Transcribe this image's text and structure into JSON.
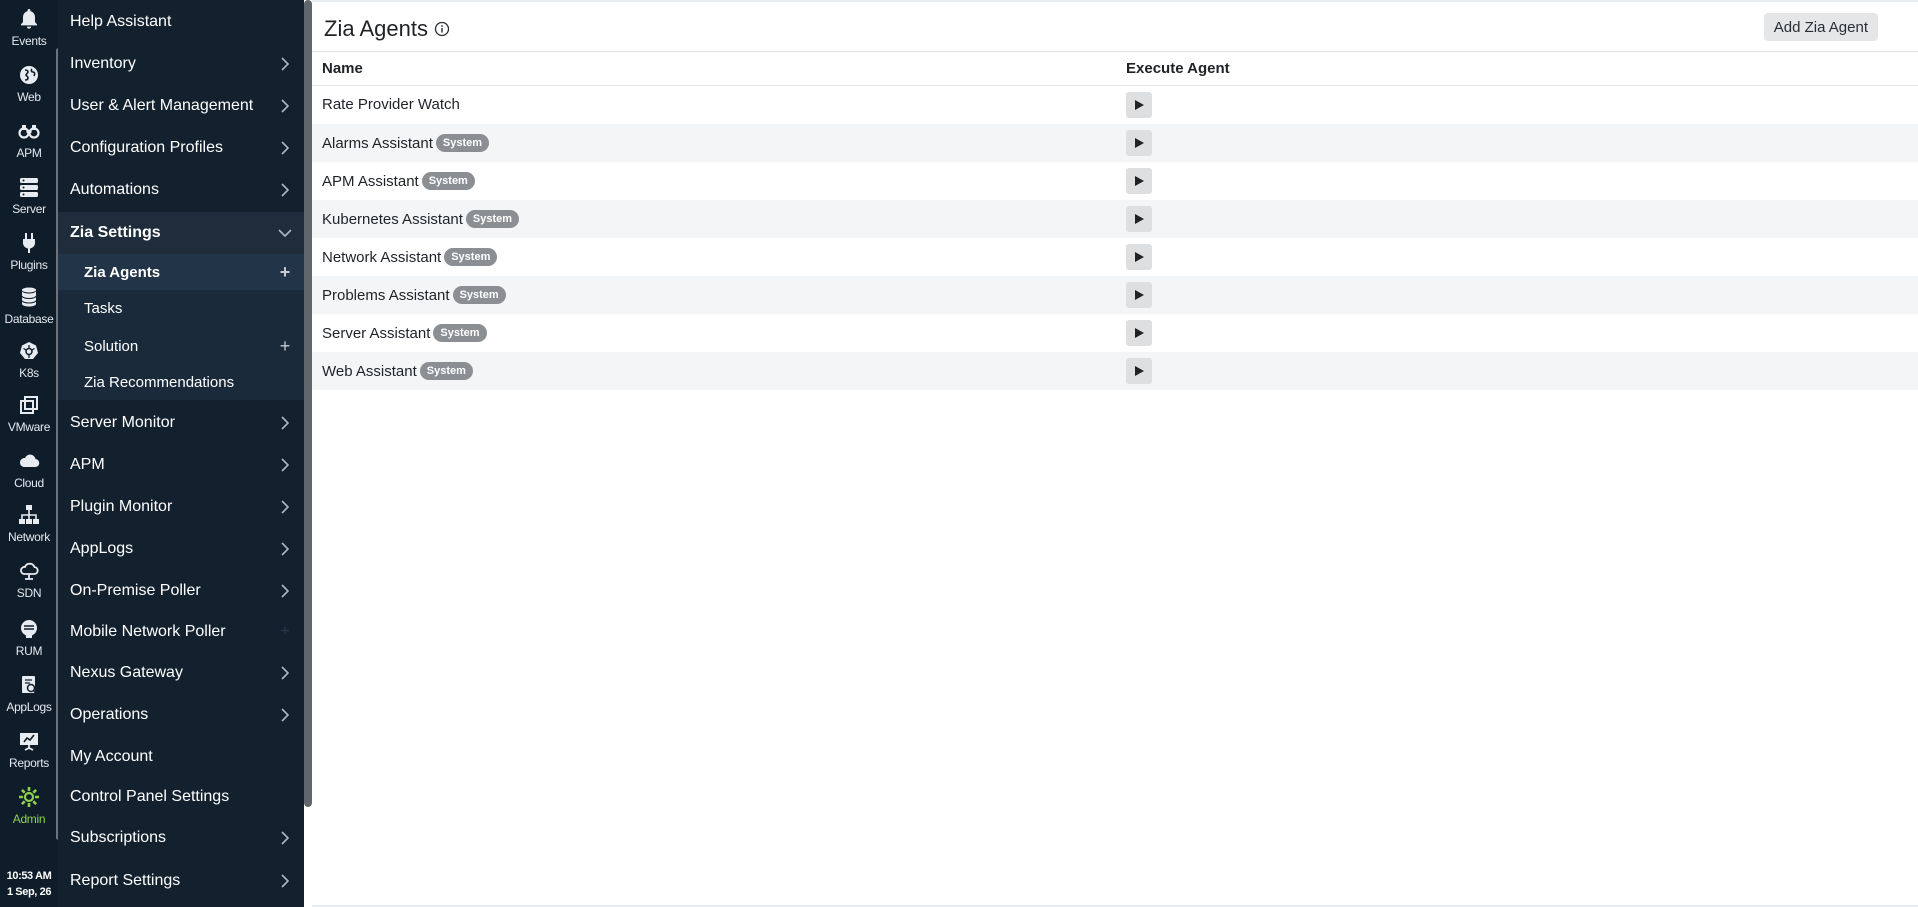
{
  "rail": {
    "items": [
      {
        "label": "Events",
        "icon": "bell-icon"
      },
      {
        "label": "Web",
        "icon": "globe-icon"
      },
      {
        "label": "APM",
        "icon": "binoculars-icon"
      },
      {
        "label": "Server",
        "icon": "server-icon"
      },
      {
        "label": "Plugins",
        "icon": "plug-icon"
      },
      {
        "label": "Database",
        "icon": "database-icon"
      },
      {
        "label": "K8s",
        "icon": "kubernetes-icon"
      },
      {
        "label": "VMware",
        "icon": "vmware-icon"
      },
      {
        "label": "Cloud",
        "icon": "cloud-icon"
      },
      {
        "label": "Network",
        "icon": "network-icon"
      },
      {
        "label": "SDN",
        "icon": "sdn-icon"
      },
      {
        "label": "RUM",
        "icon": "rum-icon"
      },
      {
        "label": "AppLogs",
        "icon": "applogs-icon"
      },
      {
        "label": "Reports",
        "icon": "reports-icon"
      },
      {
        "label": "Admin",
        "icon": "gear-icon"
      }
    ],
    "clock": {
      "time": "10:53 AM",
      "date": "1 Sep, 26"
    },
    "active_color": "#8fd14f"
  },
  "menu": {
    "items": [
      {
        "label": "Help Assistant"
      },
      {
        "label": "Inventory"
      },
      {
        "label": "User & Alert Management"
      },
      {
        "label": "Configuration Profiles"
      },
      {
        "label": "Automations"
      },
      {
        "label": "Zia Settings"
      },
      {
        "label": "Server Monitor"
      },
      {
        "label": "APM"
      },
      {
        "label": "Plugin Monitor"
      },
      {
        "label": "AppLogs"
      },
      {
        "label": "On-Premise Poller"
      },
      {
        "label": "Mobile Network Poller"
      },
      {
        "label": "Nexus Gateway"
      },
      {
        "label": "Operations"
      },
      {
        "label": "My Account"
      },
      {
        "label": "Control Panel Settings"
      },
      {
        "label": "Subscriptions"
      },
      {
        "label": "Report Settings"
      }
    ],
    "zia_sub": [
      {
        "label": "Zia Agents"
      },
      {
        "label": "Tasks"
      },
      {
        "label": "Solution"
      },
      {
        "label": "Zia Recommendations"
      }
    ]
  },
  "page": {
    "title": "Zia Agents",
    "add_button": "Add Zia Agent",
    "columns": {
      "name": "Name",
      "execute": "Execute Agent"
    },
    "rows": [
      {
        "name": "Rate Provider Watch",
        "badge": ""
      },
      {
        "name": "Alarms Assistant",
        "badge": "System"
      },
      {
        "name": "APM Assistant",
        "badge": "System"
      },
      {
        "name": "Kubernetes Assistant",
        "badge": "System"
      },
      {
        "name": "Network Assistant",
        "badge": "System"
      },
      {
        "name": "Problems Assistant",
        "badge": "System"
      },
      {
        "name": "Server Assistant",
        "badge": "System"
      },
      {
        "name": "Web Assistant",
        "badge": "System"
      }
    ]
  }
}
